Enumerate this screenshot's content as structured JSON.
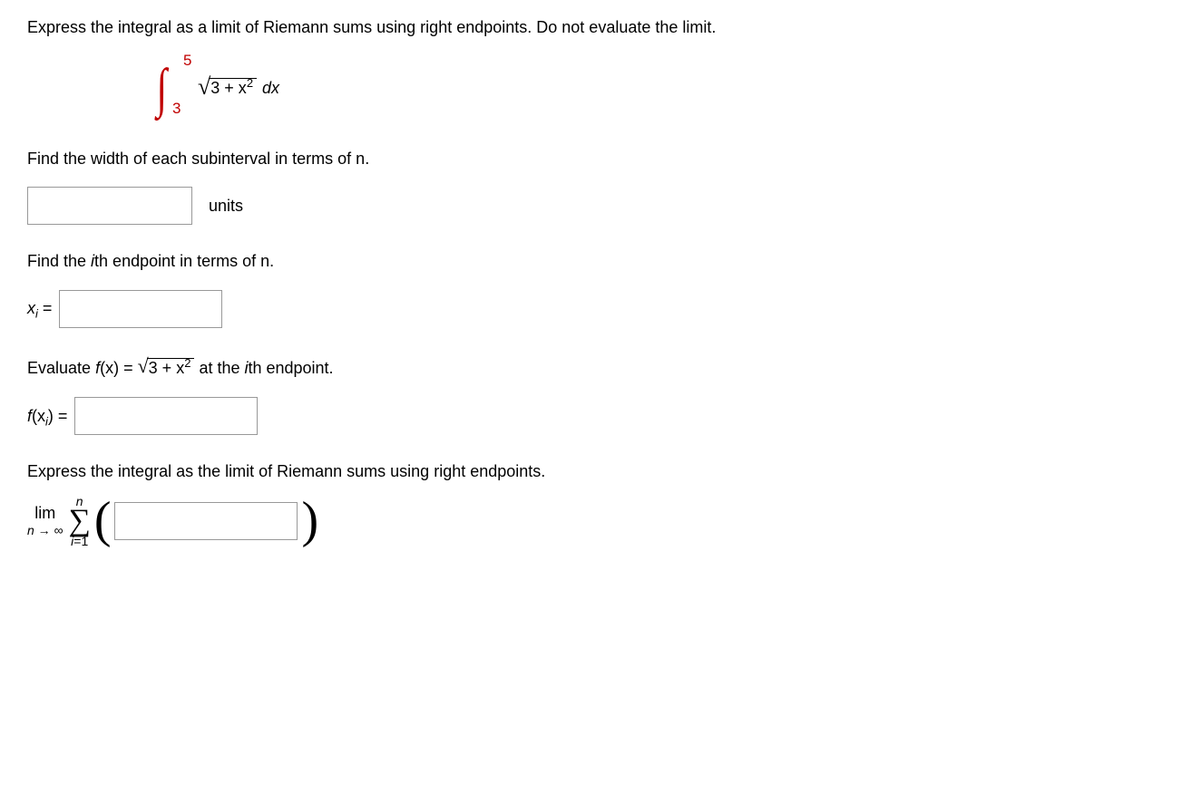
{
  "intro": "Express the integral as a limit of Riemann sums using right endpoints. Do not evaluate the limit.",
  "integral": {
    "lower": "3",
    "upper": "5",
    "radicand": "3 + x",
    "radicand_exp": "2",
    "dx": " dx"
  },
  "q1": {
    "prompt": "Find the width of each subinterval in terms of n.",
    "units": "units"
  },
  "q2": {
    "prompt_pre": "Find the ",
    "prompt_i": "i",
    "prompt_post": "th endpoint in terms of n.",
    "label_x": "x",
    "label_sub": "i",
    "label_eq": " ="
  },
  "q3": {
    "prompt_pre": "Evaluate ",
    "fx": "f",
    "paren_x": "(x) = ",
    "radicand": "3 + x",
    "radicand_exp": "2",
    "prompt_post_pre": " at the ",
    "prompt_i": "i",
    "prompt_post": "th endpoint.",
    "label_f": "f",
    "label_paren": "(x",
    "label_sub": "i",
    "label_close": ") ="
  },
  "q4": {
    "prompt": "Express the integral as the limit of Riemann sums using right endpoints.",
    "lim": "lim",
    "lim_sub_n": "n",
    "lim_sub_arrow": " → ∞",
    "sigma_top": "n",
    "sigma_bottom_i": "i",
    "sigma_bottom_eq": "=1"
  }
}
